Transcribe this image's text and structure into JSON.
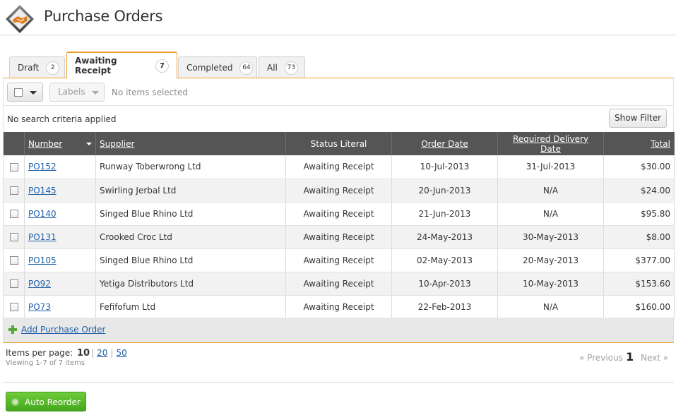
{
  "header": {
    "title": "Purchase Orders",
    "logo_icon": "handshake-diamond-icon"
  },
  "tabs": [
    {
      "label": "Draft",
      "count": "2"
    },
    {
      "label": "Awaiting Receipt",
      "count": "7"
    },
    {
      "label": "Completed",
      "count": "64"
    },
    {
      "label": "All",
      "count": "73"
    }
  ],
  "toolbar": {
    "labels": "Labels",
    "selection_status": "No items selected"
  },
  "search": {
    "status": "No search criteria applied",
    "show_filter": "Show Filter"
  },
  "table": {
    "columns": [
      "Number",
      "Supplier",
      "Status Literal",
      "Order Date",
      "Required Delivery Date",
      "Total"
    ],
    "rows": [
      {
        "number": "PO152",
        "supplier": "Runway Toberwrong Ltd",
        "status": "Awaiting Receipt",
        "order_date": "10-Jul-2013",
        "delivery": "31-Jul-2013",
        "total": "$30.00"
      },
      {
        "number": "PO145",
        "supplier": "Swirling Jerbal Ltd",
        "status": "Awaiting Receipt",
        "order_date": "20-Jun-2013",
        "delivery": "N/A",
        "total": "$24.00"
      },
      {
        "number": "PO140",
        "supplier": "Singed Blue Rhino Ltd",
        "status": "Awaiting Receipt",
        "order_date": "21-Jun-2013",
        "delivery": "N/A",
        "total": "$95.80"
      },
      {
        "number": "PO131",
        "supplier": "Crooked Croc Ltd",
        "status": "Awaiting Receipt",
        "order_date": "24-May-2013",
        "delivery": "30-May-2013",
        "total": "$8.00"
      },
      {
        "number": "PO105",
        "supplier": "Singed Blue Rhino Ltd",
        "status": "Awaiting Receipt",
        "order_date": "02-May-2013",
        "delivery": "20-May-2013",
        "total": "$377.00"
      },
      {
        "number": "PO92",
        "supplier": "Yetiga Distributors Ltd",
        "status": "Awaiting Receipt",
        "order_date": "10-Apr-2013",
        "delivery": "10-May-2013",
        "total": "$153.60"
      },
      {
        "number": "PO73",
        "supplier": "Fefifofum Ltd",
        "status": "Awaiting Receipt",
        "order_date": "22-Feb-2013",
        "delivery": "N/A",
        "total": "$160.00"
      }
    ],
    "add_link": "Add Purchase Order"
  },
  "pager": {
    "items_per_page_label": "Items per page:",
    "current_size": "10",
    "size_options": [
      "20",
      "50"
    ],
    "viewing": "Viewing 1-7 of 7 items",
    "previous": "« Previous",
    "current_page": "1",
    "next": "Next »"
  },
  "footer": {
    "auto_reorder": "Auto Reorder"
  },
  "colors": {
    "accent": "#f0a030",
    "header_row": "#555555",
    "link": "#1f5fa8",
    "button_green": "#44a81c"
  }
}
